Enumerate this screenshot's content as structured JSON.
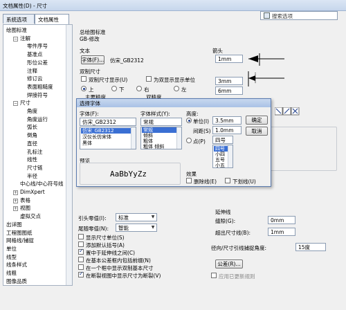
{
  "window": {
    "title": "文档属性(D) - 尺寸"
  },
  "tabs": [
    {
      "label": "系统选项(S)"
    },
    {
      "label": "文档属性(D)"
    }
  ],
  "search": {
    "placeholder": "搜索选项"
  },
  "tree": [
    {
      "label": "绘图标准",
      "level": 0,
      "exp": ""
    },
    {
      "label": "注解",
      "level": 1,
      "exp": "-"
    },
    {
      "label": "零件序号",
      "level": 2,
      "exp": ""
    },
    {
      "label": "基准点",
      "level": 2,
      "exp": ""
    },
    {
      "label": "形位公差",
      "level": 2,
      "exp": ""
    },
    {
      "label": "注释",
      "level": 2,
      "exp": ""
    },
    {
      "label": "修订云",
      "level": 2,
      "exp": ""
    },
    {
      "label": "表面粗糙度",
      "level": 2,
      "exp": ""
    },
    {
      "label": "焊接符号",
      "level": 2,
      "exp": ""
    },
    {
      "label": "尺寸",
      "level": 1,
      "exp": "-"
    },
    {
      "label": "角度",
      "level": 2,
      "exp": ""
    },
    {
      "label": "角度运行",
      "level": 2,
      "exp": ""
    },
    {
      "label": "弧长",
      "level": 2,
      "exp": ""
    },
    {
      "label": "倒角",
      "level": 2,
      "exp": ""
    },
    {
      "label": "直径",
      "level": 2,
      "exp": ""
    },
    {
      "label": "孔标注",
      "level": 2,
      "exp": ""
    },
    {
      "label": "线性",
      "level": 2,
      "exp": ""
    },
    {
      "label": "尺寸链",
      "level": 2,
      "exp": ""
    },
    {
      "label": "半径",
      "level": 2,
      "exp": ""
    },
    {
      "label": "中心线/中心符号线",
      "level": 1,
      "exp": ""
    },
    {
      "label": "DimXpert",
      "level": 1,
      "exp": "+"
    },
    {
      "label": "表格",
      "level": 1,
      "exp": "+"
    },
    {
      "label": "视图",
      "level": 1,
      "exp": "+"
    },
    {
      "label": "虚拟交点",
      "level": 1,
      "exp": ""
    },
    {
      "label": "出详图",
      "level": 0,
      "exp": ""
    },
    {
      "label": "工程图图纸",
      "level": 0,
      "exp": ""
    },
    {
      "label": "网格线/捕捉",
      "level": 0,
      "exp": ""
    },
    {
      "label": "单位",
      "level": 0,
      "exp": ""
    },
    {
      "label": "线型",
      "level": 0,
      "exp": ""
    },
    {
      "label": "线条样式",
      "level": 0,
      "exp": ""
    },
    {
      "label": "线粗",
      "level": 0,
      "exp": ""
    },
    {
      "label": "图像品质",
      "level": 0,
      "exp": ""
    }
  ],
  "main": {
    "overall_standard_label": "总绘图标准",
    "overall_standard_value": "GB-修改",
    "text_label": "文本",
    "font_button": "字体(F)...",
    "font_value": "仿宋_GB2312",
    "dual_dim_label": "双制尺寸",
    "dual_show_label": "双制尺寸显示(U)",
    "dual_units_label": "为双显示显示单位",
    "pos_top": "上",
    "pos_bottom": "下",
    "pos_right": "右",
    "pos_left": "左",
    "primary_precision_label": "主要精度",
    "dual_precision_label": "双精度",
    "arrows_label": "箭头",
    "arrow_w1": "1mm",
    "arrow_h": "3mm",
    "arrow_l": "6mm",
    "leading_zero_label": "引头零值(I):",
    "leading_zero_value": "标准",
    "trailing_zero_label": "尾随零值(N):",
    "trailing_zero_value": "智能",
    "cb_show_units": "显示尺寸单位(S)",
    "cb_add_parens": "添加默认括号(A)",
    "cb_center_ext": "置中于延伸线之间(C)",
    "cb_include_prefix": "在基本公差框内包括前缀(N)",
    "cb_same_frame": "在一个框中显示双制基本尺寸",
    "cb_broken_view": "在断裂视图中显示尺寸为断裂(V)",
    "ext_line_label": "延伸线",
    "gap_label": "缝隙(G):",
    "gap_value": "0mm",
    "beyond_label": "超出尺寸线(B):",
    "beyond_value": "1mm",
    "radial_snap_label": "径向/尺寸引线捕捉角度:",
    "radial_snap_value": "15度",
    "tolerance_button": "公差(R)...",
    "cb_update_rules": "应用已更新规则"
  },
  "dialog": {
    "title": "选择字体",
    "font_label": "字体(F):",
    "font_value": "仿宋_GB2312",
    "font_list": [
      "仿宋_GB2312",
      "汉仪长仿宋体",
      "黑体"
    ],
    "style_label": "字体样式(Y):",
    "style_value": "常规",
    "style_list": [
      "常规",
      "倾斜",
      "粗体",
      "粗体 倾斜"
    ],
    "height_label": "高度:",
    "unit_label": "单位(I)",
    "unit_value": "3.5mm",
    "spacing_label": "间距(S)",
    "spacing_value": "1.0mm",
    "point_label": "点(P)",
    "point_value": "四号",
    "point_list": [
      "四号",
      "小四",
      "五号",
      "小五"
    ],
    "ok_button": "确定",
    "cancel_button": "取消",
    "preview_label": "预览",
    "preview_text": "AaBbYyZz",
    "effects_label": "效果",
    "strike_label": "删除线(E)",
    "underline_label": "下划线(U)"
  }
}
